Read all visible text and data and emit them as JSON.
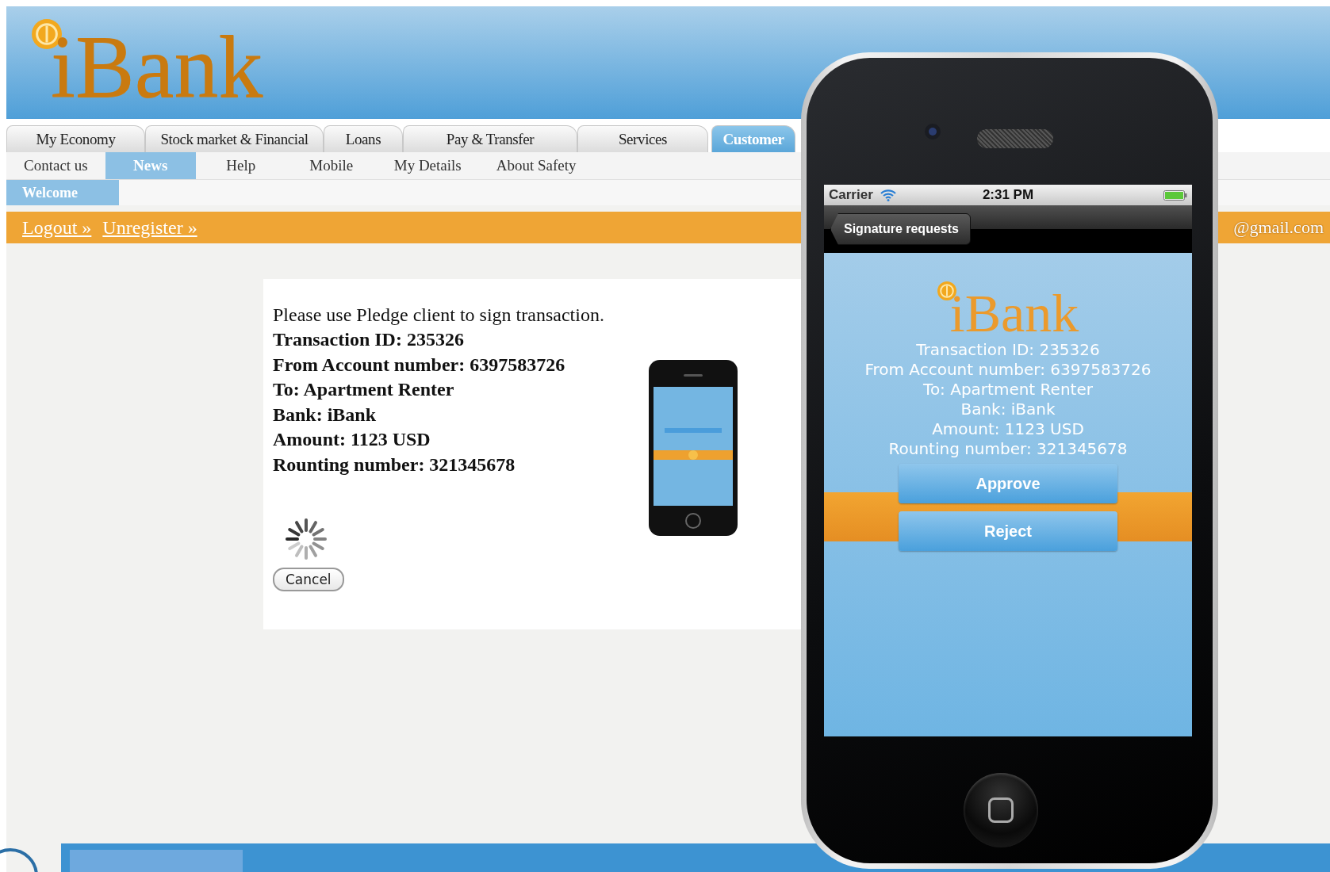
{
  "header": {
    "logo": "iBank"
  },
  "main_tabs": [
    {
      "label": "My Economy",
      "selected": false
    },
    {
      "label": "Stock market & Financial",
      "selected": false
    },
    {
      "label": "Loans",
      "selected": false
    },
    {
      "label": "Pay & Transfer",
      "selected": false
    },
    {
      "label": "Services",
      "selected": false
    },
    {
      "label": "Customer",
      "selected": true
    }
  ],
  "sub_nav": [
    {
      "label": "Contact us",
      "selected": false
    },
    {
      "label": "News",
      "selected": true
    },
    {
      "label": "Help",
      "selected": false
    },
    {
      "label": "Mobile",
      "selected": false
    },
    {
      "label": "My Details",
      "selected": false
    },
    {
      "label": "About Safety",
      "selected": false
    }
  ],
  "third_nav": [
    {
      "label": "Welcome",
      "selected": true
    }
  ],
  "user_bar": {
    "links": [
      "Logout »",
      "Unregister »"
    ],
    "email": "@gmail.com"
  },
  "signing_panel": {
    "message": "Please use Pledge client to sign transaction.",
    "details": [
      "Transaction ID: 235326",
      "From Account number: 6397583726",
      "To: Apartment Renter",
      "Bank: iBank",
      "Amount: 1123 USD",
      "Rounting number: 321345678"
    ],
    "cancel_button": "Cancel"
  },
  "phone": {
    "status_bar": {
      "carrier": "Carrier",
      "time": "2:31 PM"
    },
    "back_button": "Signature requests",
    "logo": "iBank",
    "details": [
      "Transaction ID: 235326",
      "From Account number: 6397583726",
      "To: Apartment Renter",
      "Bank: iBank",
      "Amount: 1123 USD",
      "Rounting number: 321345678"
    ],
    "buttons": [
      "Approve",
      "Reject"
    ]
  }
}
